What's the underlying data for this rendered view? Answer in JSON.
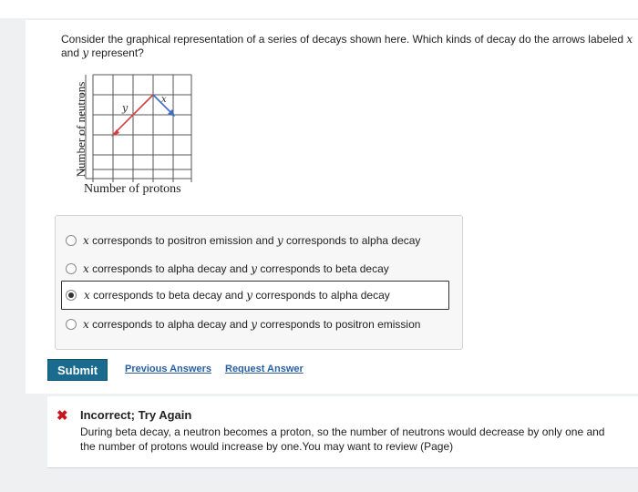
{
  "question": {
    "line1_pre": "Consider the graphical representation of a series of decays shown here. Which kinds of decay do the arrows labeled ",
    "var_x": "x",
    "line2_conj": "and ",
    "var_y": "y",
    "line2_post": " represent?"
  },
  "figure": {
    "y_axis_label": "Number of neutrons",
    "x_axis_label": "Number of protons",
    "arrow_labels": [
      "y",
      "x"
    ],
    "colors": {
      "arrow_y": "#d93a3a",
      "arrow_x": "#3b6fc4"
    }
  },
  "options": [
    {
      "x": "x",
      "mid": " corresponds to positron emission and ",
      "y": "y",
      "end": " corresponds to alpha decay",
      "selected": false
    },
    {
      "x": "x",
      "mid": " corresponds to alpha decay and ",
      "y": "y",
      "end": " corresponds to beta decay",
      "selected": false
    },
    {
      "x": "x",
      "mid": " corresponds to beta decay and ",
      "y": "y",
      "end": " corresponds to alpha decay",
      "selected": true
    },
    {
      "x": "x",
      "mid": " corresponds to alpha decay and ",
      "y": "y",
      "end": " corresponds to positron emission",
      "selected": false
    }
  ],
  "actions": {
    "submit_label": "Submit",
    "previous_answers_label": "Previous Answers",
    "request_answer_label": "Request Answer"
  },
  "feedback": {
    "status_icon": "x-mark-icon",
    "status_color": "#c4161c",
    "title": "Incorrect; Try Again",
    "line1": "During beta decay, a neutron becomes a proton, so the number of neutrons would decrease by only one and",
    "line2": "the number of protons would increase by one.You may want to review (Page)"
  }
}
